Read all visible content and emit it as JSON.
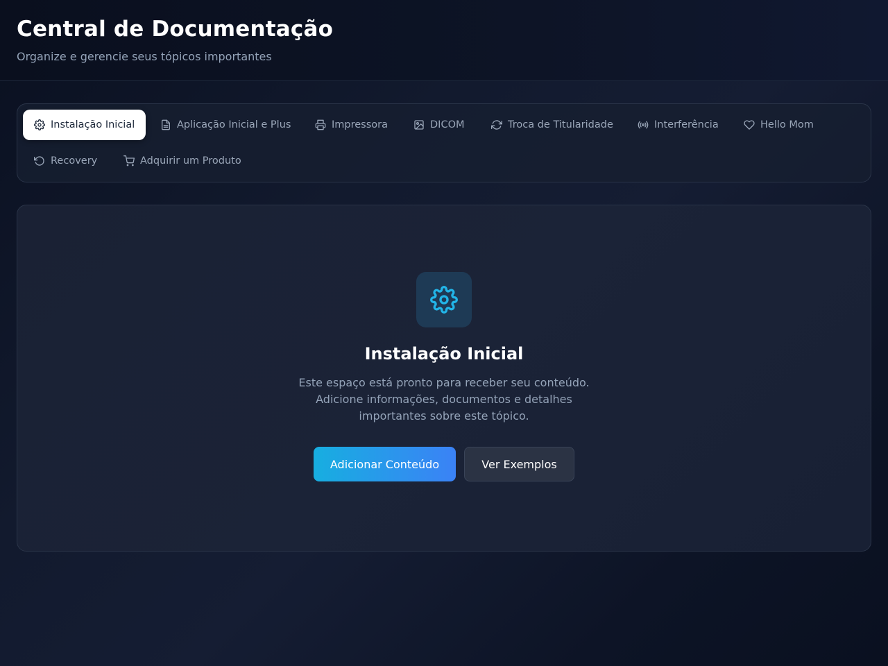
{
  "header": {
    "title": "Central de Documentação",
    "subtitle": "Organize e gerencie seus tópicos importantes"
  },
  "tabs": [
    {
      "label": "Instalação Inicial",
      "icon": "gear-icon",
      "active": true
    },
    {
      "label": "Aplicação Inicial e Plus",
      "icon": "document-icon",
      "active": false
    },
    {
      "label": "Impressora",
      "icon": "printer-icon",
      "active": false
    },
    {
      "label": "DICOM",
      "icon": "image-icon",
      "active": false
    },
    {
      "label": "Troca de Titularidade",
      "icon": "refresh-icon",
      "active": false
    },
    {
      "label": "Interferência",
      "icon": "broadcast-icon",
      "active": false
    },
    {
      "label": "Hello Mom",
      "icon": "heart-icon",
      "active": false
    },
    {
      "label": "Recovery",
      "icon": "rotate-ccw-icon",
      "active": false
    },
    {
      "label": "Adquirir um Produto",
      "icon": "cart-icon",
      "active": false
    }
  ],
  "content": {
    "icon": "gear-icon",
    "title": "Instalação Inicial",
    "description": "Este espaço está pronto para receber seu conteúdo. Adicione informações, documentos e detalhes importantes sobre este tópico.",
    "primary_button": "Adicionar Conteúdo",
    "secondary_button": "Ver Exemplos"
  },
  "colors": {
    "background": "#0b1122",
    "accent_start": "#17aee0",
    "accent_end": "#3b82f6",
    "icon_tile": "#1e3a55",
    "icon_color": "#22b5e8"
  }
}
